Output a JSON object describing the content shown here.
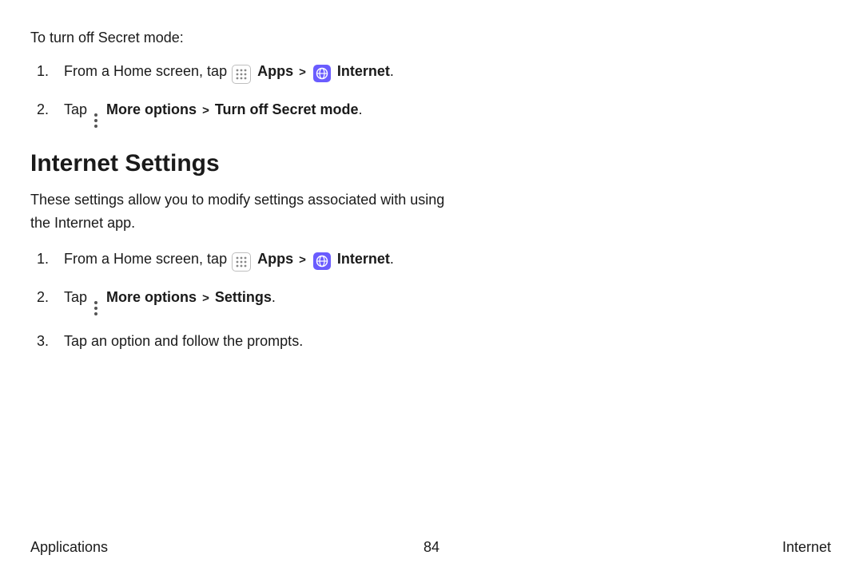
{
  "section1": {
    "intro": "To turn off Secret mode:",
    "steps": [
      {
        "prefix": "From a Home screen, tap ",
        "apps_label": "Apps",
        "sep": " > ",
        "internet_label": "Internet",
        "suffix": "."
      },
      {
        "prefix": "Tap ",
        "more_label": "More options",
        "sep": " > ",
        "action_label": "Turn off Secret mode",
        "suffix": "."
      }
    ]
  },
  "section2": {
    "heading": "Internet Settings",
    "description": "These settings allow you to modify settings associated with using the Internet app.",
    "steps": [
      {
        "prefix": "From a Home screen, tap ",
        "apps_label": "Apps",
        "sep": " > ",
        "internet_label": "Internet",
        "suffix": "."
      },
      {
        "prefix": "Tap ",
        "more_label": "More options",
        "sep": " > ",
        "action_label": "Settings",
        "suffix": "."
      },
      {
        "text": "Tap an option and follow the prompts."
      }
    ]
  },
  "footer": {
    "left": "Applications",
    "page": "84",
    "right": "Internet"
  }
}
